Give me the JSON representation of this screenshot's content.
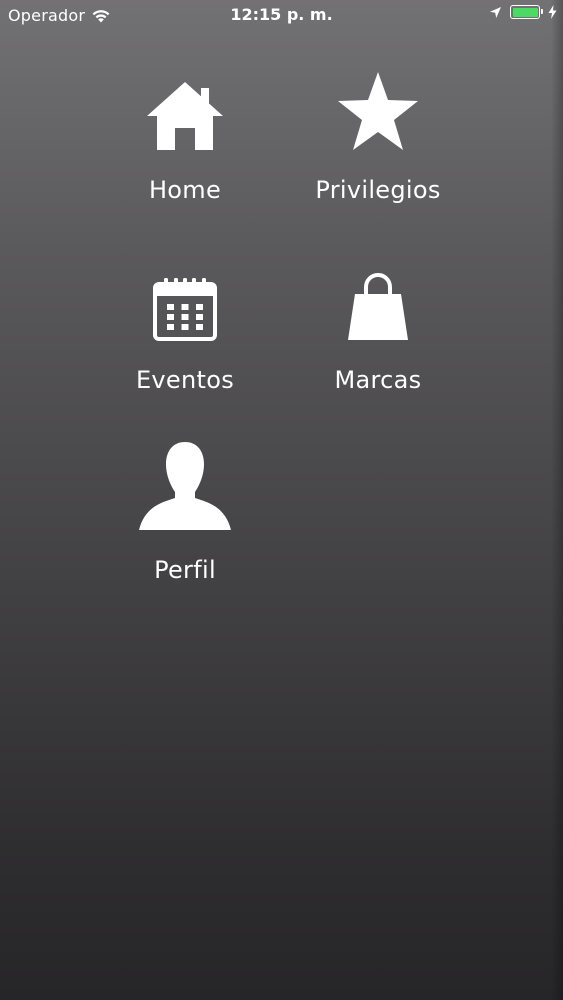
{
  "status_bar": {
    "carrier": "Operador",
    "time": "12:15 p. m.",
    "battery_color": "#4cd964"
  },
  "menu": {
    "items": [
      {
        "label": "Home",
        "icon": "home-icon"
      },
      {
        "label": "Privilegios",
        "icon": "star-icon"
      },
      {
        "label": "Eventos",
        "icon": "calendar-icon"
      },
      {
        "label": "Marcas",
        "icon": "shopping-bag-icon"
      },
      {
        "label": "Perfil",
        "icon": "user-icon"
      }
    ]
  },
  "colors": {
    "text": "#ffffff",
    "background_top": "#727173",
    "background_bottom": "#262528"
  }
}
